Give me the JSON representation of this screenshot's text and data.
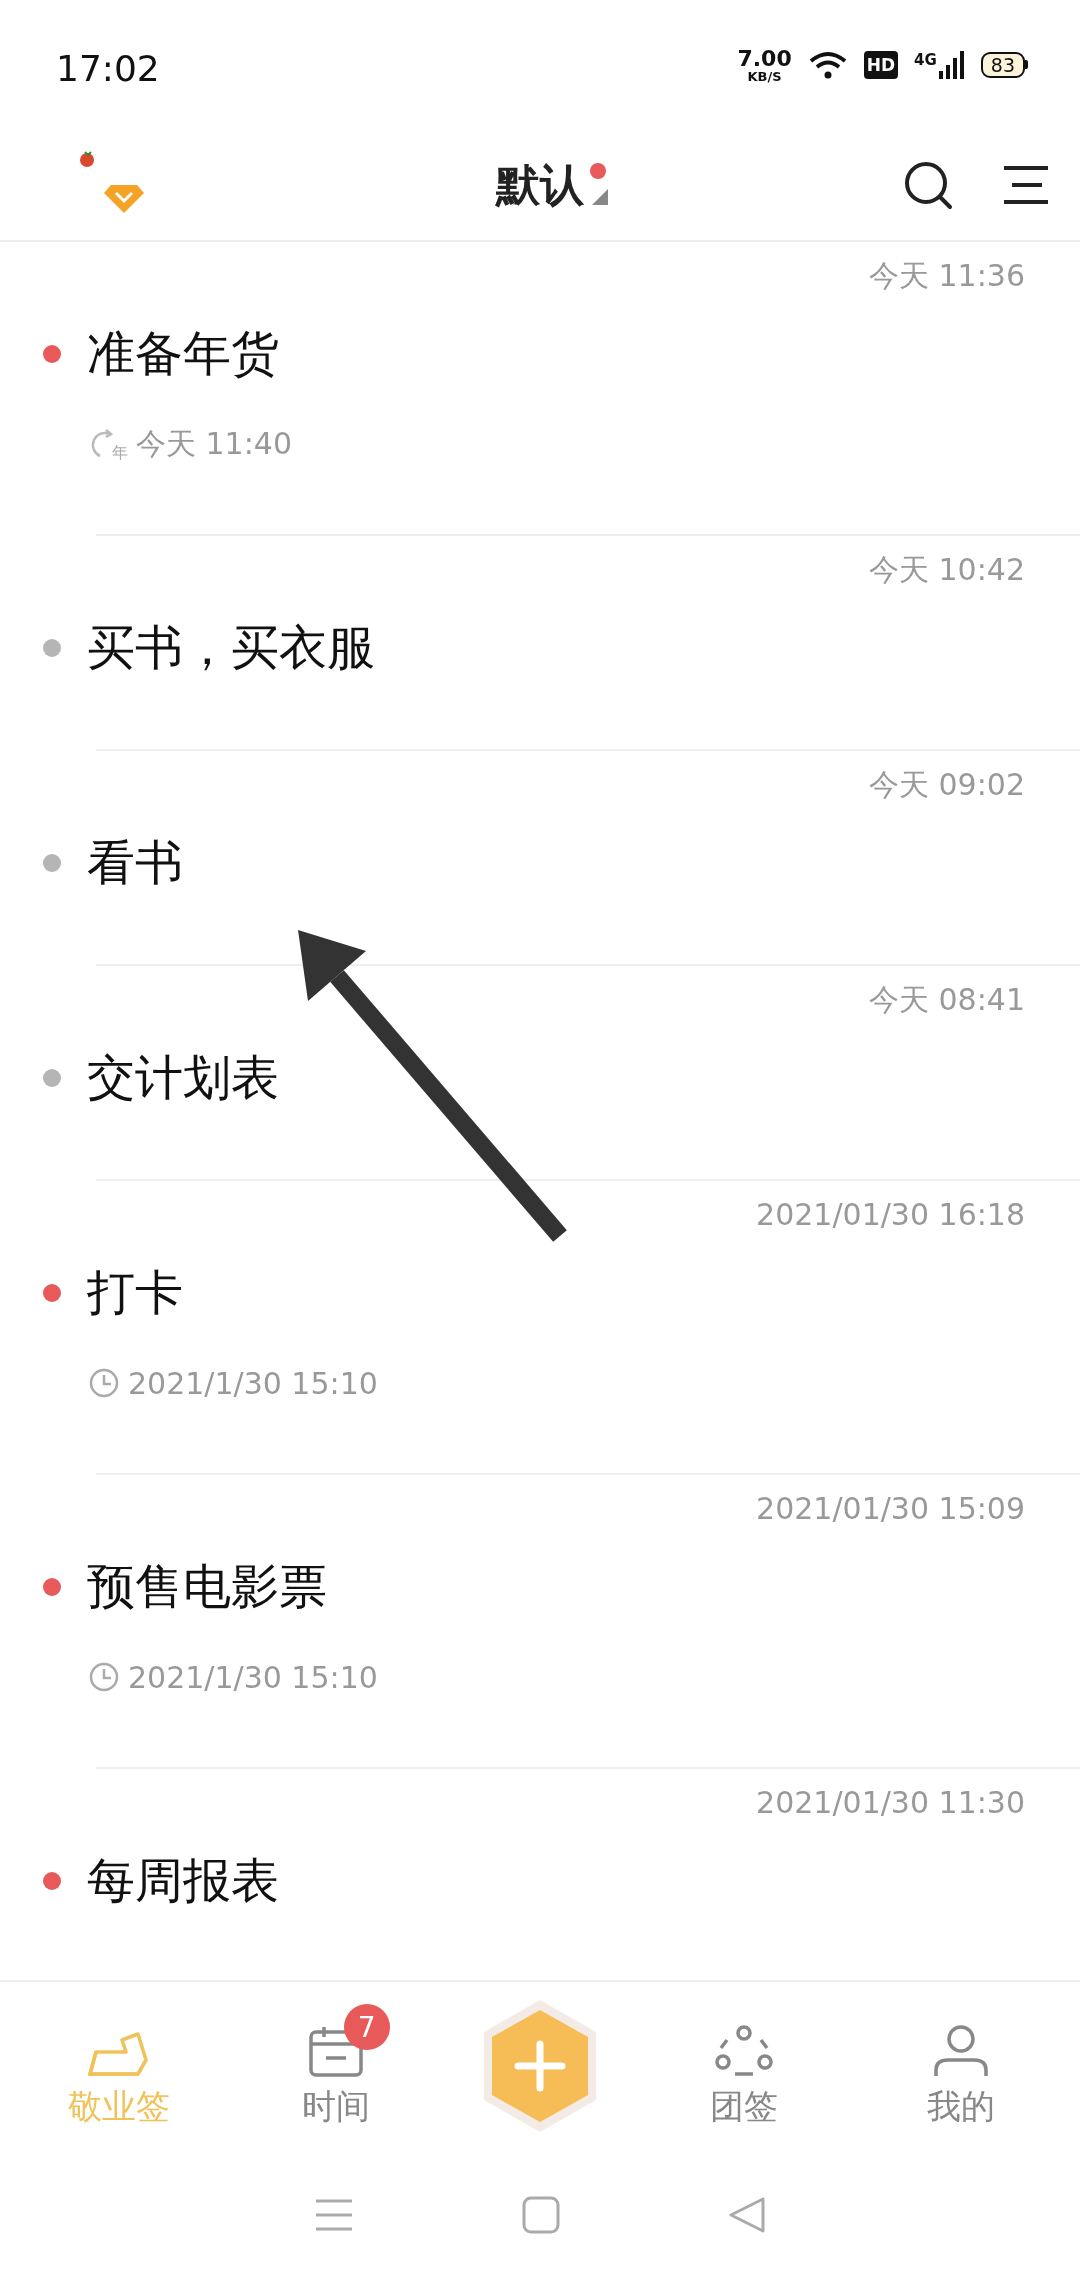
{
  "status_bar": {
    "time": "17:02",
    "net_speed": "7.00",
    "net_unit": "KB/S",
    "hd": "HD",
    "network": "4G",
    "battery": "83"
  },
  "header": {
    "title": "默认",
    "has_new": true
  },
  "notes": [
    {
      "timestamp": "今天 11:36",
      "title": "准备年货",
      "color": "#e85a5a",
      "reminder": {
        "kind": "repeat",
        "badge": "年",
        "text": "今天 11:40"
      }
    },
    {
      "timestamp": "今天 10:42",
      "title": "买书，买衣服",
      "color": "#b5b5b5"
    },
    {
      "timestamp": "今天 09:02",
      "title": "看书",
      "color": "#b5b5b5"
    },
    {
      "timestamp": "今天 08:41",
      "title": "交计划表",
      "color": "#b5b5b5"
    },
    {
      "timestamp": "2021/01/30 16:18",
      "title": "打卡",
      "color": "#e85a5a",
      "reminder": {
        "kind": "clock",
        "text": "2021/1/30 15:10"
      }
    },
    {
      "timestamp": "2021/01/30 15:09",
      "title": "预售电影票",
      "color": "#e85a5a",
      "reminder": {
        "kind": "clock",
        "text": "2021/1/30 15:10"
      }
    },
    {
      "timestamp": "2021/01/30 11:30",
      "title": "每周报表",
      "color": "#e85a5a"
    }
  ],
  "tabs": [
    {
      "kind": "notes",
      "label": "敬业签",
      "selected": true
    },
    {
      "kind": "calendar",
      "label": "时间",
      "selected": false,
      "badge": "7"
    },
    {
      "kind": "team",
      "label": "团签",
      "selected": false
    },
    {
      "kind": "profile",
      "label": "我的",
      "selected": false
    }
  ]
}
